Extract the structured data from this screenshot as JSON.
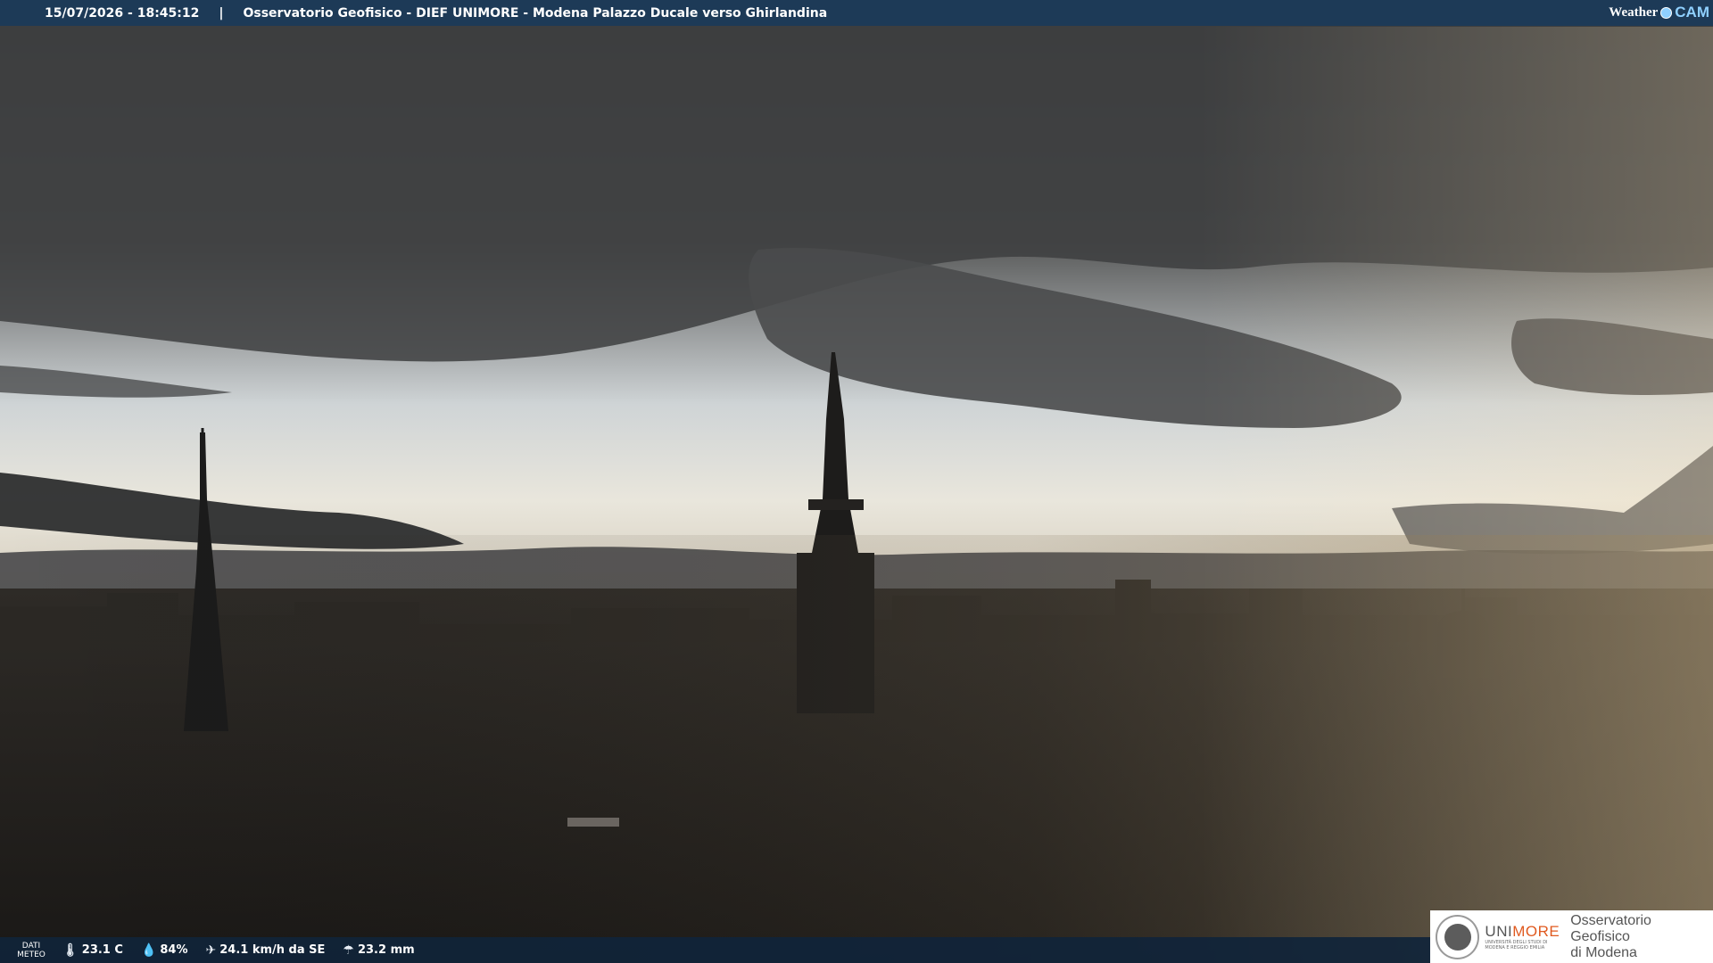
{
  "header": {
    "datetime": "15/07/2026 - 18:45:12",
    "separator": "|",
    "camera_title": "Osservatorio Geofisico - DIEF UNIMORE - Modena Palazzo Ducale verso Ghirlandina",
    "brand_weather": "Weather",
    "brand_cam": "CAM"
  },
  "weather": {
    "label_line1": "DATI",
    "label_line2": "METEO",
    "temperature": "23.1 C",
    "humidity": "84%",
    "wind": "24.1 km/h da SE",
    "rain": "23.2 mm",
    "icons": [
      "thermometer-icon",
      "humidity-icon",
      "wind-icon",
      "rain-icon"
    ]
  },
  "logo": {
    "uni_part1": "UNI",
    "uni_part2": "MORE",
    "uni_sub": "UNIVERSITÀ DEGLI STUDI DI MODENA E REGGIO EMILIA",
    "obs_line1": "Osservatorio Geofisico",
    "obs_line2": "di Modena"
  },
  "colors": {
    "bar": "#1d3a57",
    "accent_orange": "#e05a20",
    "cam_blue": "#8fd0ff"
  }
}
